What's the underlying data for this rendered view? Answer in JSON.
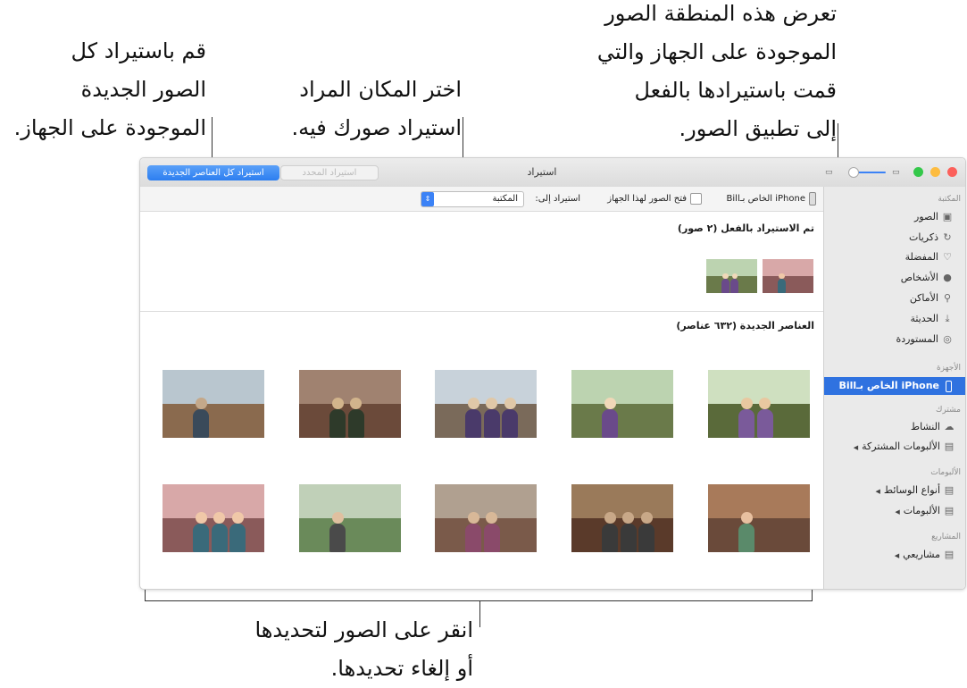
{
  "callouts": {
    "import_all": [
      "قم باستيراد كل",
      "الصور الجديدة",
      "الموجودة على الجهاز."
    ],
    "destination": [
      "اختر المكان المراد",
      "استيراد صورك فيه."
    ],
    "already_imported": [
      "تعرض هذه المنطقة الصور",
      "الموجودة على الجهاز والتي",
      "قمت باستيرادها بالفعل",
      "إلى تطبيق الصور."
    ],
    "click_photos": [
      "انقر على الصور لتحديدها",
      "أو إلغاء تحديدها."
    ]
  },
  "window": {
    "title": "استيراد",
    "import_all_button": "استيراد كل العناصر الجديدة",
    "import_selected_button": "استيراد المحدد"
  },
  "toolbar": {
    "device_name": "iPhone الخاص بـBill",
    "open_photos_label": "فتح الصور لهذا الجهاز",
    "import_to_label": "استيراد إلى:",
    "import_to_value": "المكتبة"
  },
  "sections": {
    "already_imported_title": "تم الاستيراد بالفعل (٢ صور)",
    "new_items_title": "العناصر الجديدة (٦٣٢ عناصر)"
  },
  "sidebar": {
    "library_header": "المكتبة",
    "library_items": [
      {
        "label": "الصور",
        "icon": "photos-icon"
      },
      {
        "label": "ذكريات",
        "icon": "memories-icon"
      },
      {
        "label": "المفضلة",
        "icon": "heart-icon"
      },
      {
        "label": "الأشخاص",
        "icon": "person-icon"
      },
      {
        "label": "الأماكن",
        "icon": "pin-icon"
      },
      {
        "label": "الحديثة",
        "icon": "import-icon"
      },
      {
        "label": "المستوردة",
        "icon": "camera-icon"
      }
    ],
    "devices_header": "الأجهزة",
    "device_item": "iPhone الخاص بـBill",
    "shared_header": "مشترك",
    "shared_items": [
      {
        "label": "النشاط",
        "icon": "cloud-icon"
      },
      {
        "label": "الألبومات المشتركة",
        "icon": "folder-icon"
      }
    ],
    "albums_header": "الألبومات",
    "album_items": [
      {
        "label": "أنواع الوسائط",
        "icon": "folder-icon"
      },
      {
        "label": "الألبومات",
        "icon": "folder-icon"
      }
    ],
    "projects_header": "المشاريع",
    "project_items": [
      {
        "label": "مشاريعي",
        "icon": "folder-icon"
      }
    ]
  },
  "colors": {
    "accent": "#2f72e0",
    "close": "#fc605b",
    "minimize": "#fdbc40",
    "zoom": "#34c84a"
  }
}
